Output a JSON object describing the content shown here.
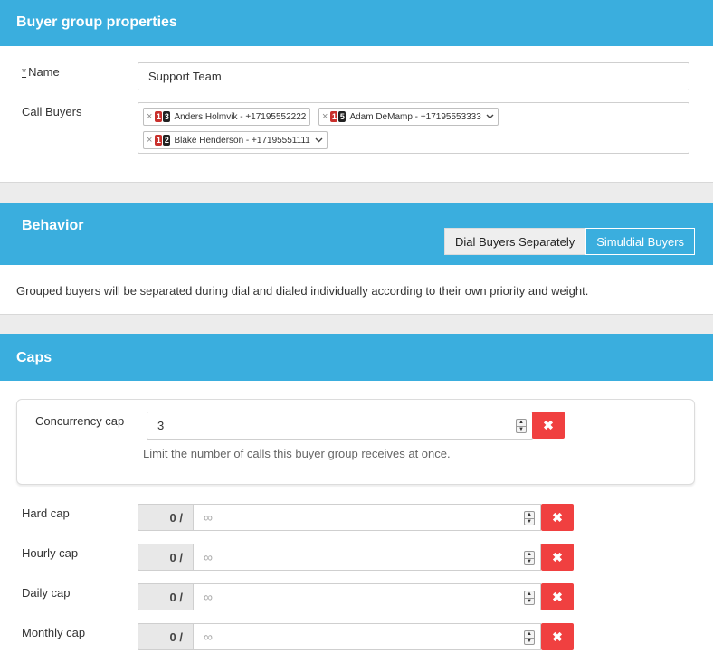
{
  "buyer_group": {
    "title": "Buyer group properties",
    "name_required_mark": "*",
    "name_label": "Name",
    "name_value": "Support Team",
    "call_buyers_label": "Call Buyers",
    "call_buyers": [
      {
        "badge1": "1",
        "badge2": "3",
        "name": "Anders Holmvik - +17195552222",
        "has_dropdown": false
      },
      {
        "badge1": "1",
        "badge2": "5",
        "name": "Adam DeMamp - +17195553333",
        "has_dropdown": true
      },
      {
        "badge1": "1",
        "badge2": "2",
        "name": "Blake Henderson - +17195551111",
        "has_dropdown": true
      }
    ]
  },
  "behavior": {
    "title": "Behavior",
    "options": [
      "Dial Buyers Separately",
      "Simuldial Buyers"
    ],
    "selected": "Dial Buyers Separately",
    "description": "Grouped buyers will be separated during dial and dialed individually according to their own priority and weight."
  },
  "caps": {
    "title": "Caps",
    "concurrency": {
      "label": "Concurrency cap",
      "value": "3",
      "hint": "Limit the number of calls this buyer group receives at once."
    },
    "rows": [
      {
        "label": "Hard cap",
        "current": "0 /",
        "placeholder": "∞"
      },
      {
        "label": "Hourly cap",
        "current": "0 /",
        "placeholder": "∞"
      },
      {
        "label": "Daily cap",
        "current": "0 /",
        "placeholder": "∞"
      },
      {
        "label": "Monthly cap",
        "current": "0 /",
        "placeholder": "∞"
      }
    ]
  },
  "icons": {
    "remove": "×",
    "chevron": "⌄",
    "delete": "✖",
    "spin_up": "▲",
    "spin_down": "▼"
  },
  "colors": {
    "header_blue": "#3aaede",
    "delete_red": "#f04040",
    "badge_red": "#c9302c",
    "badge_dark": "#222222"
  }
}
